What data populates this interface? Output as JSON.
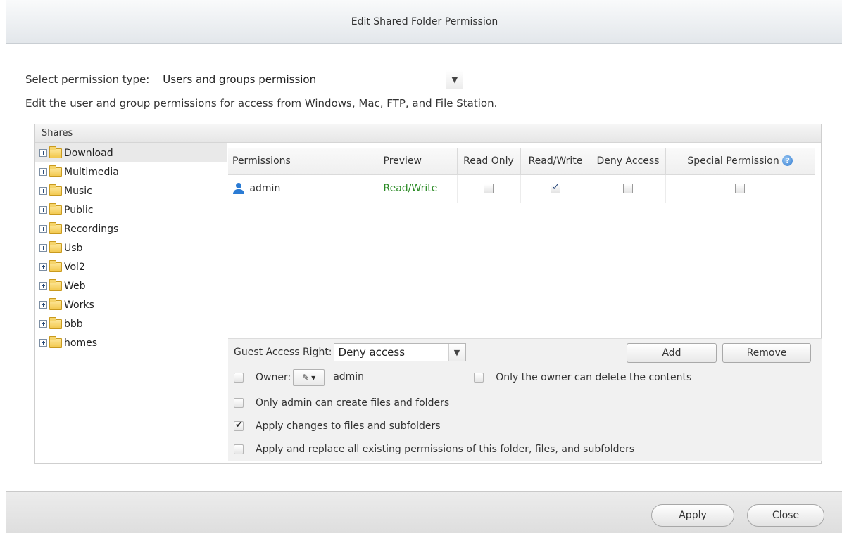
{
  "dialog": {
    "title": "Edit Shared Folder Permission"
  },
  "permission_type": {
    "label": "Select permission type:",
    "selected": "Users and groups permission"
  },
  "description": "Edit the user and group permissions for access from Windows, Mac, FTP, and File Station.",
  "shares": {
    "header": "Shares",
    "folders": [
      "Download",
      "Multimedia",
      "Music",
      "Public",
      "Recordings",
      "Usb",
      "Vol2",
      "Web",
      "Works",
      "bbb",
      "homes"
    ],
    "selected_index": 0
  },
  "permissions_table": {
    "columns": [
      "Permissions",
      "Preview",
      "Read Only",
      "Read/Write",
      "Deny Access",
      "Special Permission"
    ],
    "rows": [
      {
        "user": "admin",
        "preview": "Read/Write",
        "read_only": false,
        "read_write": true,
        "deny_access": false,
        "special_permission": false
      }
    ]
  },
  "guest_access": {
    "label": "Guest Access Right:",
    "selected": "Deny access"
  },
  "buttons": {
    "add": "Add",
    "remove": "Remove",
    "apply": "Apply",
    "close": "Close"
  },
  "options": {
    "owner_label": "Owner:",
    "owner_value": "admin",
    "owner_only_delete": "Only the owner can delete the contents",
    "admin_only_create": "Only admin can create files and folders",
    "apply_changes": "Apply changes to files and subfolders",
    "apply_replace": "Apply and replace all existing permissions of this folder, files, and subfolders",
    "owner_checked": false,
    "owner_only_delete_checked": false,
    "admin_only_create_checked": false,
    "apply_changes_checked": true,
    "apply_replace_checked": false
  }
}
